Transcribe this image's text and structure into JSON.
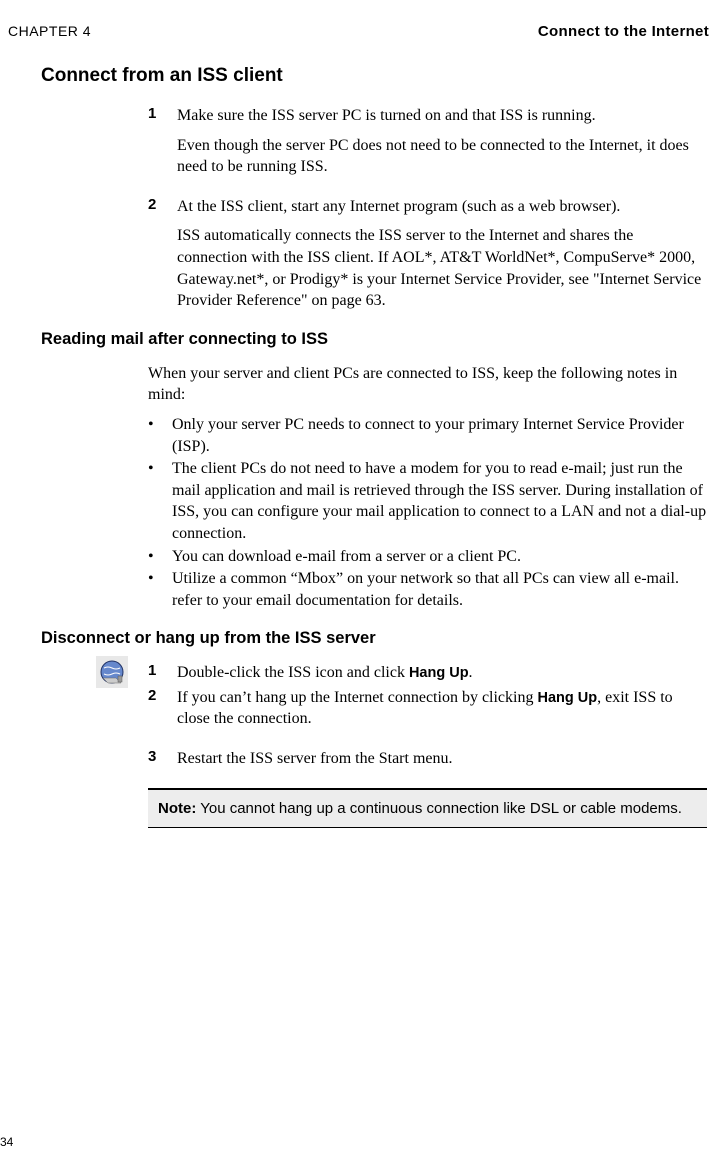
{
  "header": {
    "chapter": "CHAPTER 4",
    "title": "Connect to the Internet"
  },
  "section1": {
    "title": "Connect from an ISS client",
    "steps": [
      {
        "num": "1",
        "paras": [
          "Make sure the ISS server PC is turned on and that ISS is running.",
          "Even though the server PC does not need to be connected to the Internet, it does need to be running ISS."
        ]
      },
      {
        "num": "2",
        "paras": [
          "At the ISS client, start any Internet program (such as a web browser).",
          "ISS automatically connects the ISS server to the Internet and shares the connection with the ISS client. If AOL*, AT&T WorldNet*, CompuServe* 2000, Gateway.net*, or Prodigy* is your Internet Service Provider, see \"Internet Service Provider Reference\" on page 63."
        ]
      }
    ]
  },
  "section2": {
    "title": "Reading mail after connecting to ISS",
    "intro": "When your server and client PCs are connected to ISS, keep the following notes in mind:",
    "bullets": [
      "Only your server PC needs to connect to your primary Internet Service Provider (ISP).",
      "The client PCs do not need to have a modem for you to read e-mail; just run the mail application and mail is retrieved through the ISS server. During installation of ISS, you can configure your mail application to connect to a LAN and not a dial-up connection.",
      "You can download e-mail from a server or a client PC.",
      "Utilize a common “Mbox” on your network so that all PCs can view all e-mail. refer to your email documentation for details."
    ]
  },
  "section3": {
    "title": "Disconnect or hang up from the ISS server",
    "step1": {
      "num": "1",
      "pre": "Double-click the ISS icon and click ",
      "bold": "Hang Up",
      "post": "."
    },
    "step2": {
      "num": "2",
      "pre": "If you can’t hang up the Internet connection by clicking ",
      "bold": "Hang Up",
      "post": ", exit ISS to close the connection."
    },
    "step3": {
      "num": "3",
      "text": "Restart the ISS server from the Start menu."
    }
  },
  "note": {
    "label": "Note:",
    "text": "  You cannot hang up a continuous connection like DSL or cable modems."
  },
  "pageNumber": "34"
}
